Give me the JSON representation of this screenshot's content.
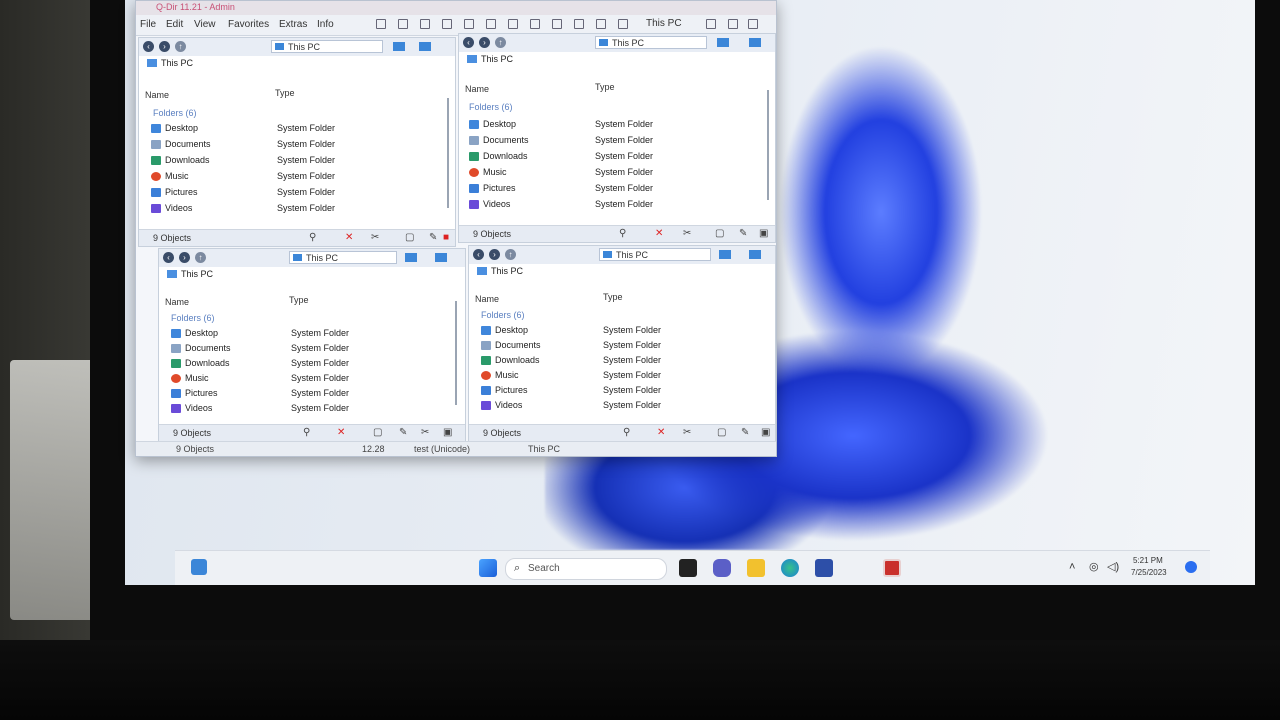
{
  "window": {
    "title": "Q-Dir 11.21 - Admin",
    "menu": [
      "File",
      "Edit",
      "View",
      "Favorites",
      "Extras",
      "Info"
    ],
    "location_label": "This PC"
  },
  "panes": [
    {
      "address": "This PC",
      "tab": "This PC",
      "col_name": "Name",
      "col_type": "Type",
      "group": "Folders (6)",
      "rows": [
        {
          "name": "Desktop",
          "type": "System Folder",
          "icon": "desktop-folder-icon",
          "color": "#3f86db"
        },
        {
          "name": "Documents",
          "type": "System Folder",
          "icon": "documents-folder-icon",
          "color": "#8aa3c4"
        },
        {
          "name": "Downloads",
          "type": "System Folder",
          "icon": "downloads-folder-icon",
          "color": "#2a9a6a"
        },
        {
          "name": "Music",
          "type": "System Folder",
          "icon": "music-folder-icon",
          "color": "#e04a2a"
        },
        {
          "name": "Pictures",
          "type": "System Folder",
          "icon": "pictures-folder-icon",
          "color": "#3b7fd8"
        },
        {
          "name": "Videos",
          "type": "System Folder",
          "icon": "videos-folder-icon",
          "color": "#6a4bd8"
        }
      ],
      "status": "9 Objects"
    },
    {
      "address": "This PC",
      "tab": "This PC",
      "col_name": "Name",
      "col_type": "Type",
      "group": "Folders (6)",
      "rows": [
        {
          "name": "Desktop",
          "type": "System Folder",
          "icon": "desktop-folder-icon",
          "color": "#3f86db"
        },
        {
          "name": "Documents",
          "type": "System Folder",
          "icon": "documents-folder-icon",
          "color": "#8aa3c4"
        },
        {
          "name": "Downloads",
          "type": "System Folder",
          "icon": "downloads-folder-icon",
          "color": "#2a9a6a"
        },
        {
          "name": "Music",
          "type": "System Folder",
          "icon": "music-folder-icon",
          "color": "#e04a2a"
        },
        {
          "name": "Pictures",
          "type": "System Folder",
          "icon": "pictures-folder-icon",
          "color": "#3b7fd8"
        },
        {
          "name": "Videos",
          "type": "System Folder",
          "icon": "videos-folder-icon",
          "color": "#6a4bd8"
        }
      ],
      "status": "9 Objects"
    },
    {
      "address": "This PC",
      "tab": "This PC",
      "col_name": "Name",
      "col_type": "Type",
      "group": "Folders (6)",
      "rows": [
        {
          "name": "Desktop",
          "type": "System Folder",
          "icon": "desktop-folder-icon",
          "color": "#3f86db"
        },
        {
          "name": "Documents",
          "type": "System Folder",
          "icon": "documents-folder-icon",
          "color": "#8aa3c4"
        },
        {
          "name": "Downloads",
          "type": "System Folder",
          "icon": "downloads-folder-icon",
          "color": "#2a9a6a"
        },
        {
          "name": "Music",
          "type": "System Folder",
          "icon": "music-folder-icon",
          "color": "#e04a2a"
        },
        {
          "name": "Pictures",
          "type": "System Folder",
          "icon": "pictures-folder-icon",
          "color": "#3b7fd8"
        },
        {
          "name": "Videos",
          "type": "System Folder",
          "icon": "videos-folder-icon",
          "color": "#6a4bd8"
        }
      ],
      "status": "9 Objects"
    },
    {
      "address": "This PC",
      "tab": "This PC",
      "col_name": "Name",
      "col_type": "Type",
      "group": "Folders (6)",
      "rows": [
        {
          "name": "Desktop",
          "type": "System Folder",
          "icon": "desktop-folder-icon",
          "color": "#3f86db"
        },
        {
          "name": "Documents",
          "type": "System Folder",
          "icon": "documents-folder-icon",
          "color": "#8aa3c4"
        },
        {
          "name": "Downloads",
          "type": "System Folder",
          "icon": "downloads-folder-icon",
          "color": "#2a9a6a"
        },
        {
          "name": "Music",
          "type": "System Folder",
          "icon": "music-folder-icon",
          "color": "#e04a2a"
        },
        {
          "name": "Pictures",
          "type": "System Folder",
          "icon": "pictures-folder-icon",
          "color": "#3b7fd8"
        },
        {
          "name": "Videos",
          "type": "System Folder",
          "icon": "videos-folder-icon",
          "color": "#6a4bd8"
        }
      ],
      "status": "9 Objects"
    }
  ],
  "main_status": {
    "objects": "9 Objects",
    "size": "12.28",
    "encoding": "test (Unicode)",
    "location": "This PC"
  },
  "taskbar": {
    "search_placeholder": "Search",
    "time": "5:21 PM",
    "date": "7/25/2023",
    "icons": [
      "widgets-icon",
      "start-icon",
      "task-view-icon",
      "teams-icon",
      "file-explorer-icon",
      "edge-icon",
      "store-icon",
      "qdir-icon"
    ]
  },
  "colors": {
    "accent": "#3b86d8",
    "close_red": "#d22222",
    "wallpaper_blue": "#2240e0"
  }
}
